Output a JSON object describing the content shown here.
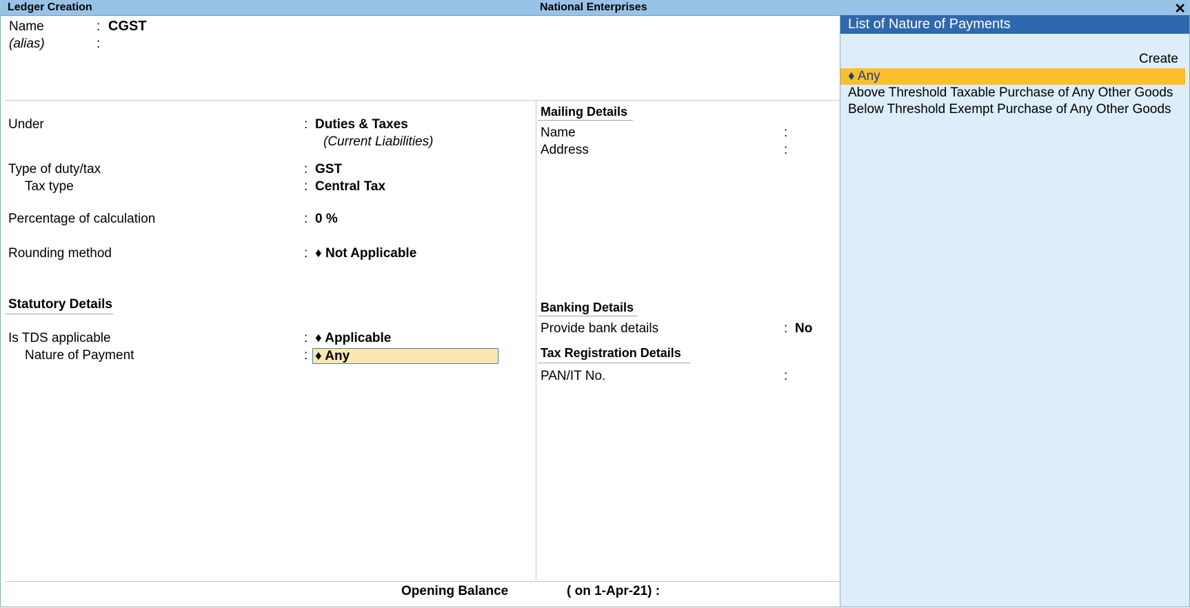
{
  "titlebar": {
    "left_title": "Ledger Creation",
    "center_title": "National Enterprises",
    "close_glyph": "✕"
  },
  "header": {
    "name_label": "Name",
    "name_value": "CGST",
    "alias_label": "(alias)",
    "colon": ":"
  },
  "left": {
    "under_label": "Under",
    "under_value": "Duties & Taxes",
    "under_sub": "(Current Liabilities)",
    "type_label": "Type of duty/tax",
    "type_value": "GST",
    "taxtype_label": "Tax type",
    "taxtype_value": "Central Tax",
    "pct_label": "Percentage of calculation",
    "pct_value": "0 %",
    "rounding_label": "Rounding method",
    "rounding_value": "♦ Not Applicable",
    "statutory_heading": "Statutory Details",
    "tds_label": "Is TDS applicable",
    "tds_value": "♦ Applicable",
    "nop_label": "Nature of Payment",
    "nop_value": "♦ Any"
  },
  "right": {
    "mailing_heading": "Mailing Details",
    "mail_name_label": "Name",
    "mail_address_label": "Address",
    "banking_heading": "Banking Details",
    "bank_label": "Provide bank details",
    "bank_value": "No",
    "taxreg_heading": "Tax Registration Details",
    "pan_label": "PAN/IT No."
  },
  "footer": {
    "opening_label": "Opening Balance",
    "opening_date": "( on 1-Apr-21)  :"
  },
  "panel": {
    "title": "List of Nature of Payments",
    "create_label": "Create",
    "items": [
      "♦ Any",
      "Above Threshold Taxable Purchase of Any Other Goods",
      "Below Threshold Exempt Purchase of Any Other Goods"
    ],
    "selected_color": "#fbbf2d",
    "title_color": "#2f68ac"
  }
}
